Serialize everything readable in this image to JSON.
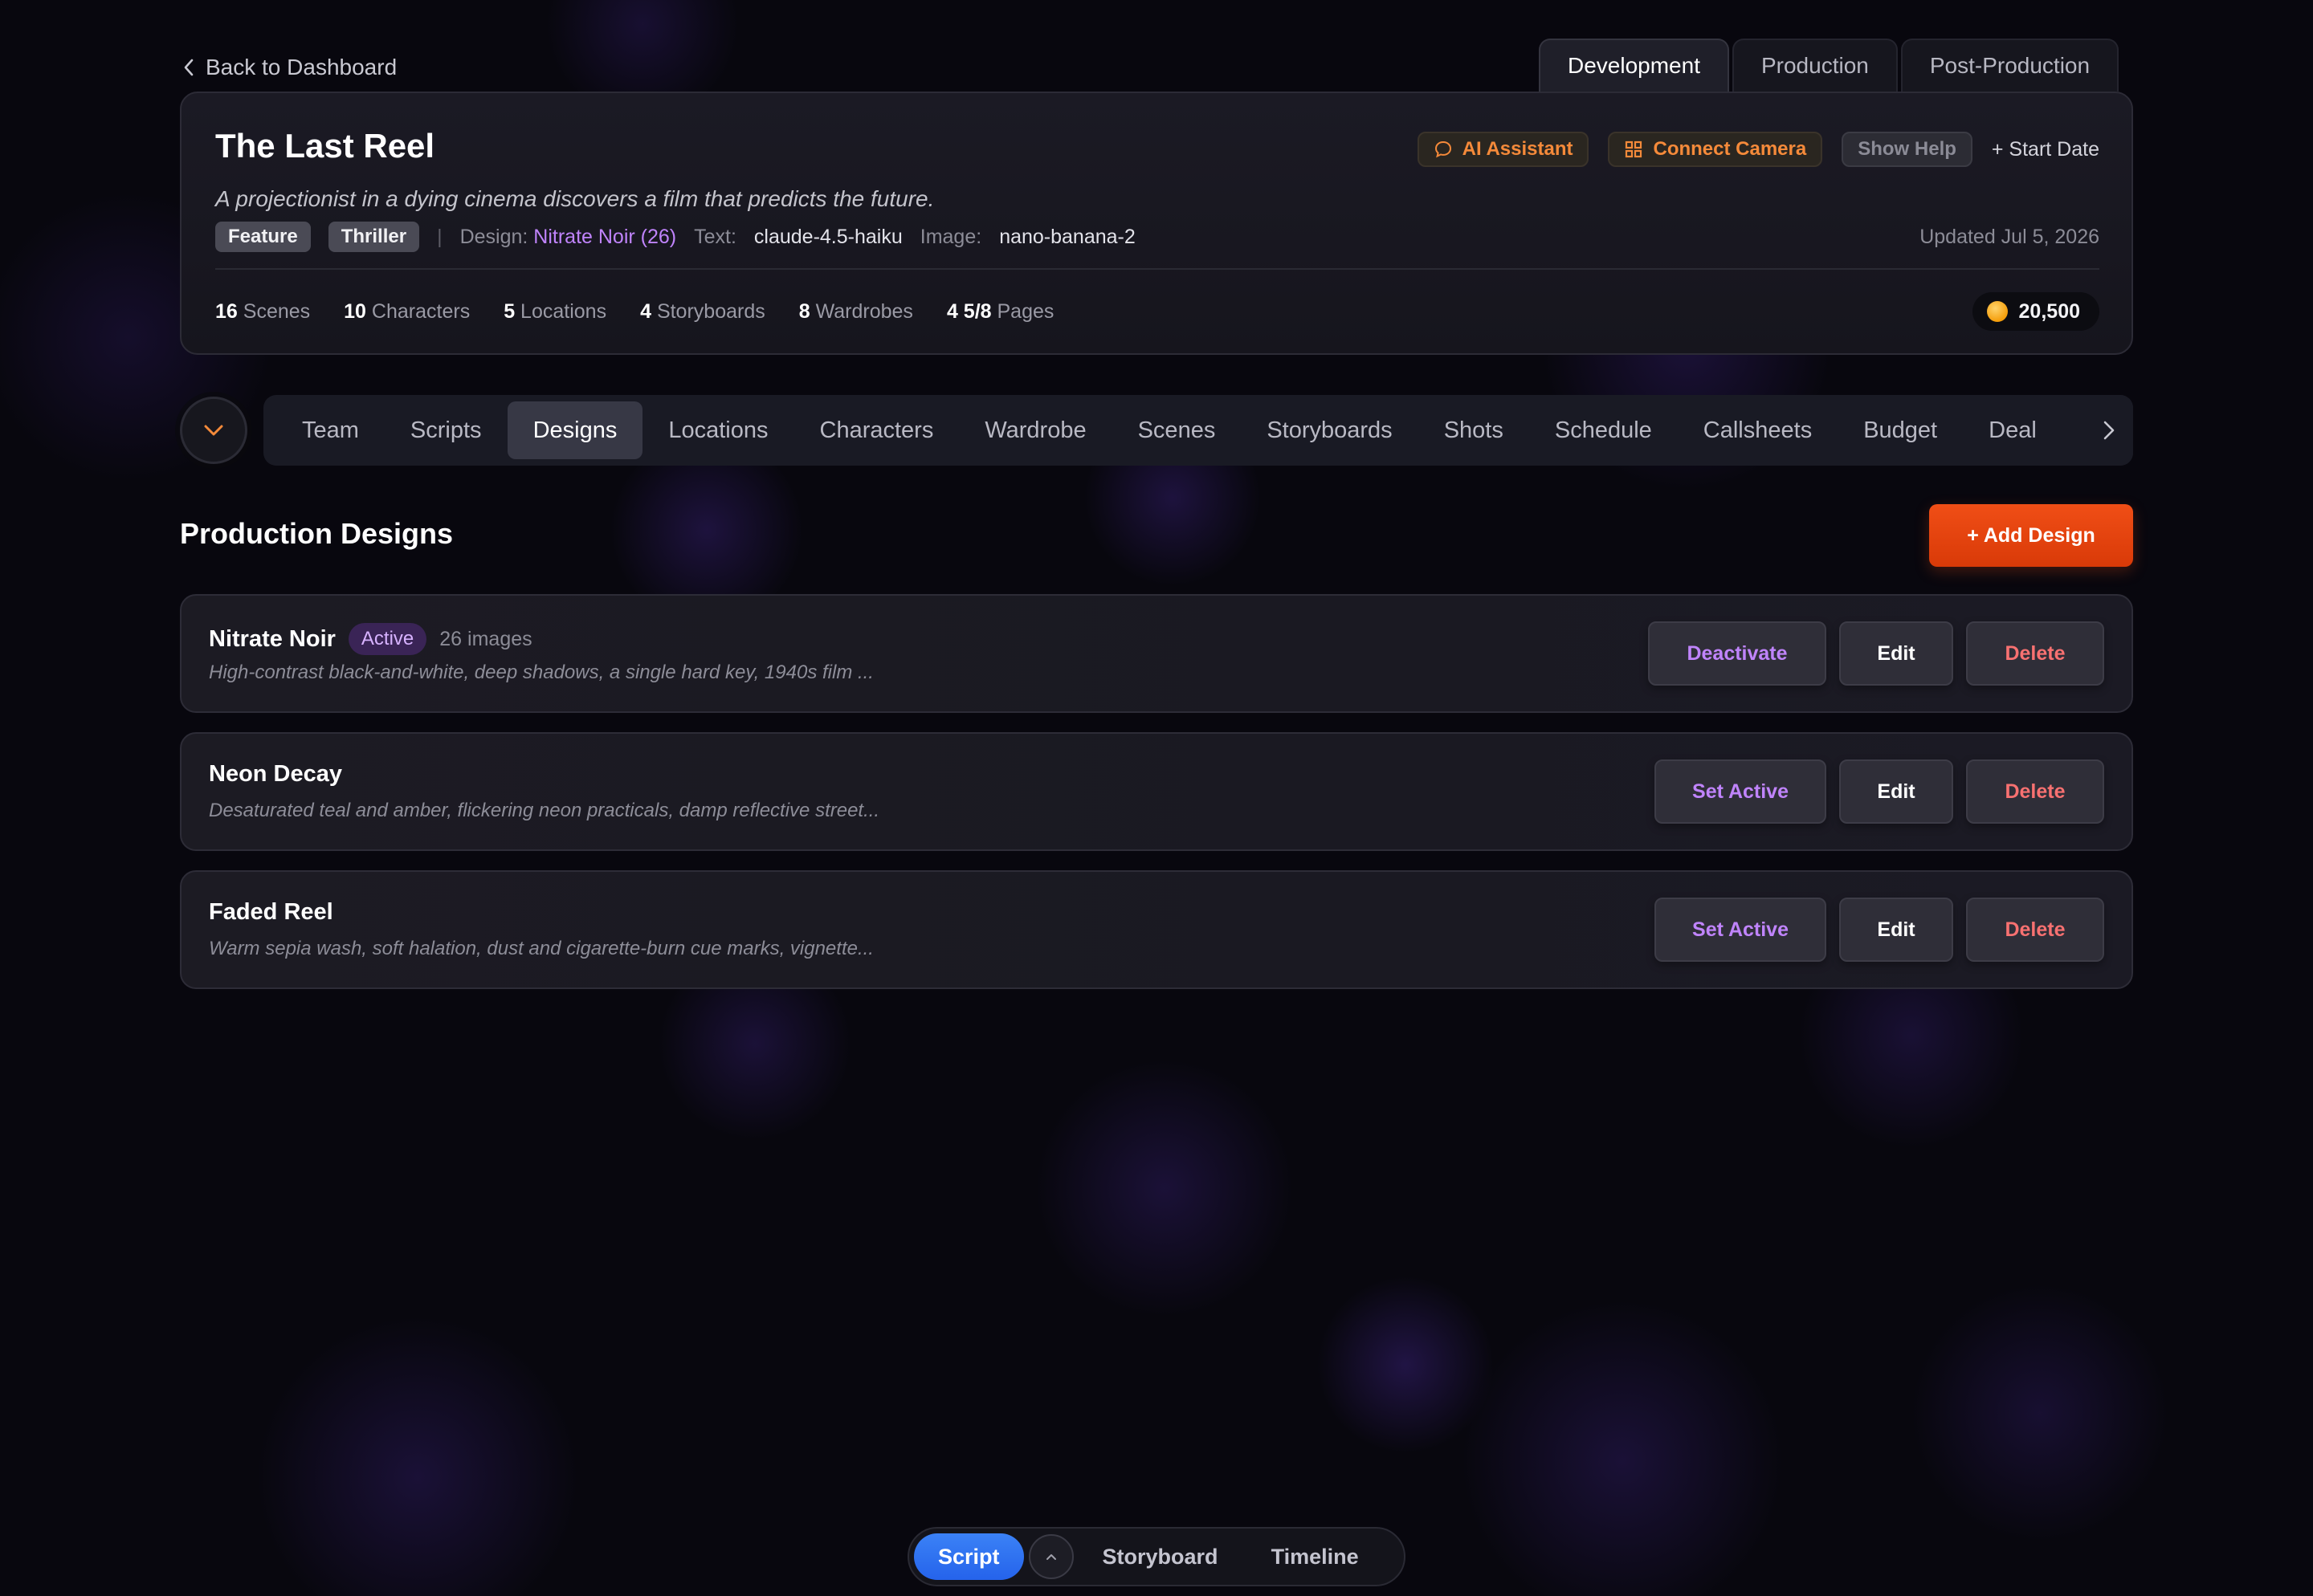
{
  "nav": {
    "back_label": "Back to Dashboard",
    "phase_tabs": [
      "Development",
      "Production",
      "Post-Production"
    ],
    "active_phase": "Development"
  },
  "project": {
    "title": "The Last Reel",
    "logline": "A projectionist in a dying cinema discovers a film that predicts the future.",
    "actions": {
      "ai_assistant": "AI Assistant",
      "connect_camera": "Connect Camera",
      "show_help": "Show Help",
      "start_date": "+ Start Date"
    },
    "tags": [
      "Feature",
      "Thriller"
    ],
    "separator": "|",
    "design_label": "Design:",
    "design_value": "Nitrate Noir (26)",
    "text_label": "Text:",
    "text_model": "claude-4.5-haiku",
    "image_label": "Image:",
    "image_model": "nano-banana-2",
    "updated": "Updated Jul 5, 2026",
    "stats": [
      {
        "value": "16",
        "label": "Scenes"
      },
      {
        "value": "10",
        "label": "Characters"
      },
      {
        "value": "5",
        "label": "Locations"
      },
      {
        "value": "4",
        "label": "Storyboards"
      },
      {
        "value": "8",
        "label": "Wardrobes"
      },
      {
        "value": "4 5/8",
        "label": "Pages"
      }
    ],
    "credits": "20,500"
  },
  "section_nav": {
    "items": [
      "Team",
      "Scripts",
      "Designs",
      "Locations",
      "Characters",
      "Wardrobe",
      "Scenes",
      "Storyboards",
      "Shots",
      "Schedule",
      "Callsheets",
      "Budget",
      "Deal"
    ],
    "active": "Designs"
  },
  "designs": {
    "title": "Production Designs",
    "add_label": "+ Add Design",
    "edit_label": "Edit",
    "delete_label": "Delete",
    "items": [
      {
        "name": "Nitrate Noir",
        "badge": "Active",
        "images": "26 images",
        "description": "High-contrast black-and-white, deep shadows, a single hard key, 1940s film ...",
        "primary_action": "Deactivate"
      },
      {
        "name": "Neon Decay",
        "description": "Desaturated teal and amber, flickering neon practicals, damp reflective street...",
        "primary_action": "Set Active"
      },
      {
        "name": "Faded Reel",
        "description": "Warm sepia wash, soft halation, dust and cigarette-burn cue marks, vignette...",
        "primary_action": "Set Active"
      }
    ]
  },
  "dock": {
    "items": [
      "Script",
      "Storyboard",
      "Timeline"
    ],
    "active": "Script"
  },
  "colors": {
    "accent_orange": "#f04e16",
    "accent_purple": "#c084fc",
    "delete_red": "#f87171",
    "dock_blue": "#2563eb"
  }
}
